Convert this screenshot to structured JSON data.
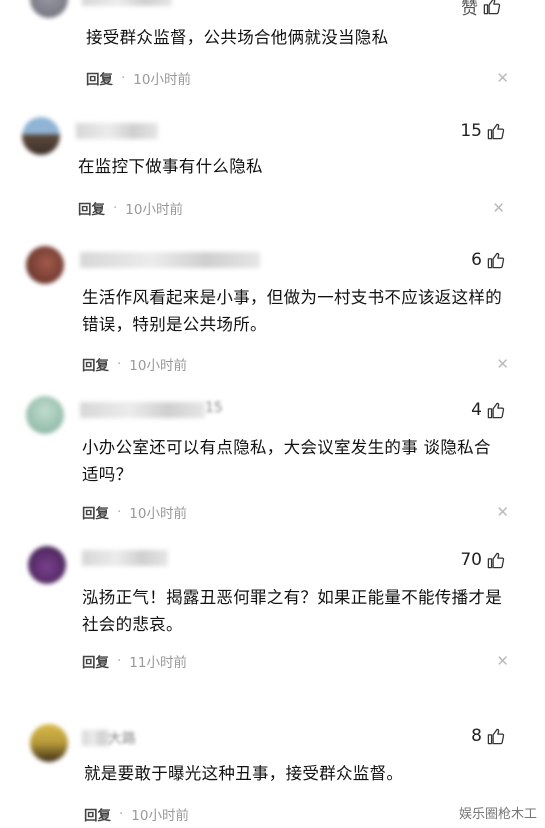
{
  "comments": [
    {
      "avatar_color": "#6d6d7a",
      "username": "",
      "likes": "赞",
      "body": "接受群众监督，公共场合他俩就没当隐私",
      "reply": "回复",
      "time": "10小时前"
    },
    {
      "avatar_color": "#7fa6c4",
      "username": "",
      "likes": "15",
      "body": "在监控下做事有什么隐私",
      "reply": "回复",
      "time": "10小时前"
    },
    {
      "avatar_color": "#8a4a3f",
      "username": "",
      "likes": "6",
      "body": "生活作风看起来是小事，但做为一村支书不应该返这样的错误，特别是公共场所。",
      "reply": "回复",
      "time": "10小时前"
    },
    {
      "avatar_color": "#9cc4b4",
      "username": "15",
      "likes": "4",
      "body": "小办公室还可以有点隐私，大会议室发生的事 谈隐私合适吗？",
      "reply": "回复",
      "time": "10小时前"
    },
    {
      "avatar_color": "#5a2f6b",
      "username": "",
      "likes": "70",
      "body": "泓扬正气！揭露丑恶何罪之有？如果正能量不能传播才是社会的悲哀。",
      "reply": "回复",
      "time": "11小时前"
    },
    {
      "avatar_color": "#b89a3a",
      "username": "大路",
      "likes": "8",
      "body": "就是要敢于曝光这种丑事，接受群众监督。",
      "reply": "回复",
      "time": "10小时前"
    }
  ],
  "watermark": "娱乐圈枪木工"
}
